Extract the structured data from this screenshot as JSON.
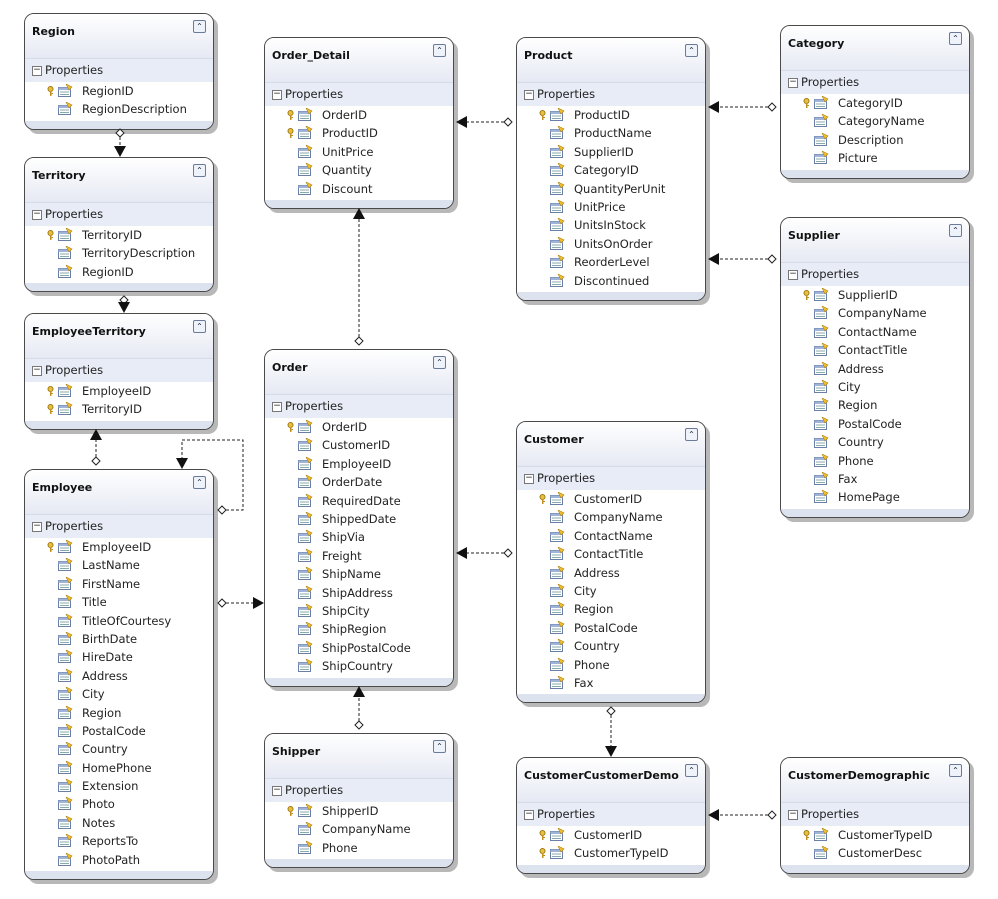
{
  "section_label": "Properties",
  "entities": [
    {
      "id": "region",
      "name": "Region",
      "fields": [
        {
          "name": "RegionID",
          "key": true
        },
        {
          "name": "RegionDescription",
          "key": false
        }
      ]
    },
    {
      "id": "territory",
      "name": "Territory",
      "fields": [
        {
          "name": "TerritoryID",
          "key": true
        },
        {
          "name": "TerritoryDescription",
          "key": false
        },
        {
          "name": "RegionID",
          "key": false
        }
      ]
    },
    {
      "id": "employeeterritory",
      "name": "EmployeeTerritory",
      "fields": [
        {
          "name": "EmployeeID",
          "key": true
        },
        {
          "name": "TerritoryID",
          "key": true
        }
      ]
    },
    {
      "id": "employee",
      "name": "Employee",
      "fields": [
        {
          "name": "EmployeeID",
          "key": true
        },
        {
          "name": "LastName",
          "key": false
        },
        {
          "name": "FirstName",
          "key": false
        },
        {
          "name": "Title",
          "key": false
        },
        {
          "name": "TitleOfCourtesy",
          "key": false
        },
        {
          "name": "BirthDate",
          "key": false
        },
        {
          "name": "HireDate",
          "key": false
        },
        {
          "name": "Address",
          "key": false
        },
        {
          "name": "City",
          "key": false
        },
        {
          "name": "Region",
          "key": false
        },
        {
          "name": "PostalCode",
          "key": false
        },
        {
          "name": "Country",
          "key": false
        },
        {
          "name": "HomePhone",
          "key": false
        },
        {
          "name": "Extension",
          "key": false
        },
        {
          "name": "Photo",
          "key": false
        },
        {
          "name": "Notes",
          "key": false
        },
        {
          "name": "ReportsTo",
          "key": false
        },
        {
          "name": "PhotoPath",
          "key": false
        }
      ]
    },
    {
      "id": "order_detail",
      "name": "Order_Detail",
      "fields": [
        {
          "name": "OrderID",
          "key": true
        },
        {
          "name": "ProductID",
          "key": true
        },
        {
          "name": "UnitPrice",
          "key": false
        },
        {
          "name": "Quantity",
          "key": false
        },
        {
          "name": "Discount",
          "key": false
        }
      ]
    },
    {
      "id": "order",
      "name": "Order",
      "fields": [
        {
          "name": "OrderID",
          "key": true
        },
        {
          "name": "CustomerID",
          "key": false
        },
        {
          "name": "EmployeeID",
          "key": false
        },
        {
          "name": "OrderDate",
          "key": false
        },
        {
          "name": "RequiredDate",
          "key": false
        },
        {
          "name": "ShippedDate",
          "key": false
        },
        {
          "name": "ShipVia",
          "key": false
        },
        {
          "name": "Freight",
          "key": false
        },
        {
          "name": "ShipName",
          "key": false
        },
        {
          "name": "ShipAddress",
          "key": false
        },
        {
          "name": "ShipCity",
          "key": false
        },
        {
          "name": "ShipRegion",
          "key": false
        },
        {
          "name": "ShipPostalCode",
          "key": false
        },
        {
          "name": "ShipCountry",
          "key": false
        }
      ]
    },
    {
      "id": "shipper",
      "name": "Shipper",
      "fields": [
        {
          "name": "ShipperID",
          "key": true
        },
        {
          "name": "CompanyName",
          "key": false
        },
        {
          "name": "Phone",
          "key": false
        }
      ]
    },
    {
      "id": "product",
      "name": "Product",
      "fields": [
        {
          "name": "ProductID",
          "key": true
        },
        {
          "name": "ProductName",
          "key": false
        },
        {
          "name": "SupplierID",
          "key": false
        },
        {
          "name": "CategoryID",
          "key": false
        },
        {
          "name": "QuantityPerUnit",
          "key": false
        },
        {
          "name": "UnitPrice",
          "key": false
        },
        {
          "name": "UnitsInStock",
          "key": false
        },
        {
          "name": "UnitsOnOrder",
          "key": false
        },
        {
          "name": "ReorderLevel",
          "key": false
        },
        {
          "name": "Discontinued",
          "key": false
        }
      ]
    },
    {
      "id": "customer",
      "name": "Customer",
      "fields": [
        {
          "name": "CustomerID",
          "key": true
        },
        {
          "name": "CompanyName",
          "key": false
        },
        {
          "name": "ContactName",
          "key": false
        },
        {
          "name": "ContactTitle",
          "key": false
        },
        {
          "name": "Address",
          "key": false
        },
        {
          "name": "City",
          "key": false
        },
        {
          "name": "Region",
          "key": false
        },
        {
          "name": "PostalCode",
          "key": false
        },
        {
          "name": "Country",
          "key": false
        },
        {
          "name": "Phone",
          "key": false
        },
        {
          "name": "Fax",
          "key": false
        }
      ]
    },
    {
      "id": "customercustomerdemo",
      "name": "CustomerCustomerDemo",
      "fields": [
        {
          "name": "CustomerID",
          "key": true
        },
        {
          "name": "CustomerTypeID",
          "key": true
        }
      ]
    },
    {
      "id": "category",
      "name": "Category",
      "fields": [
        {
          "name": "CategoryID",
          "key": true
        },
        {
          "name": "CategoryName",
          "key": false
        },
        {
          "name": "Description",
          "key": false
        },
        {
          "name": "Picture",
          "key": false
        }
      ]
    },
    {
      "id": "supplier",
      "name": "Supplier",
      "fields": [
        {
          "name": "SupplierID",
          "key": true
        },
        {
          "name": "CompanyName",
          "key": false
        },
        {
          "name": "ContactName",
          "key": false
        },
        {
          "name": "ContactTitle",
          "key": false
        },
        {
          "name": "Address",
          "key": false
        },
        {
          "name": "City",
          "key": false
        },
        {
          "name": "Region",
          "key": false
        },
        {
          "name": "PostalCode",
          "key": false
        },
        {
          "name": "Country",
          "key": false
        },
        {
          "name": "Phone",
          "key": false
        },
        {
          "name": "Fax",
          "key": false
        },
        {
          "name": "HomePage",
          "key": false
        }
      ]
    },
    {
      "id": "customerdemographic",
      "name": "CustomerDemographic",
      "fields": [
        {
          "name": "CustomerTypeID",
          "key": true
        },
        {
          "name": "CustomerDesc",
          "key": false
        }
      ]
    }
  ],
  "associations": [
    {
      "from": "region",
      "to": "territory"
    },
    {
      "from": "territory",
      "to": "employeeterritory"
    },
    {
      "from": "employee",
      "to": "employeeterritory"
    },
    {
      "from": "employee",
      "to": "employee"
    },
    {
      "from": "employee",
      "to": "order"
    },
    {
      "from": "order",
      "to": "order_detail"
    },
    {
      "from": "product",
      "to": "order_detail"
    },
    {
      "from": "category",
      "to": "product"
    },
    {
      "from": "supplier",
      "to": "product"
    },
    {
      "from": "customer",
      "to": "order"
    },
    {
      "from": "shipper",
      "to": "order"
    },
    {
      "from": "customer",
      "to": "customercustomerdemo"
    },
    {
      "from": "customerdemographic",
      "to": "customercustomerdemo"
    }
  ]
}
